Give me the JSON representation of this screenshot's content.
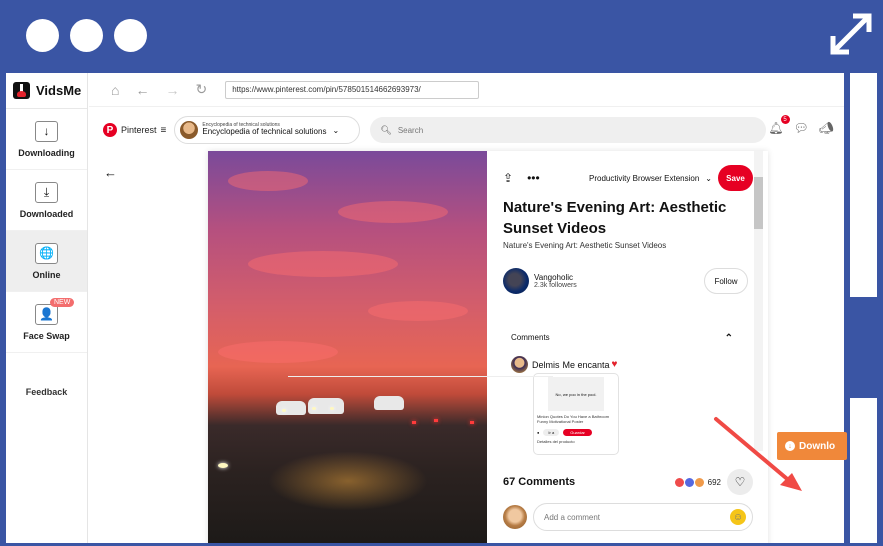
{
  "window_controls": {
    "dots": 3,
    "expand_icon": "expand-diagonal-icon"
  },
  "app": {
    "name": "VidsMe",
    "nav": [
      {
        "label": "Downloading",
        "icon": "download-arrow-icon",
        "active": false
      },
      {
        "label": "Downloaded",
        "icon": "download-tray-icon",
        "active": false
      },
      {
        "label": "Online",
        "icon": "globe-icon",
        "active": true
      },
      {
        "label": "Face Swap",
        "icon": "face-icon",
        "active": false,
        "badge": "NEW"
      }
    ],
    "feedback_label": "Feedback"
  },
  "browser": {
    "url": "https://www.pinterest.com/pin/578501514662693973/",
    "buttons": [
      "home-icon",
      "back-icon",
      "forward-icon",
      "reload-icon"
    ]
  },
  "pinterest": {
    "logo_text": "Pinterest",
    "account_small": "Encyclopedia of technical solutions",
    "account_big": "Encyclopedia of technical solutions",
    "search_placeholder": "Search",
    "notifications_count": "5"
  },
  "pin": {
    "board": "Productivity Browser Extension",
    "save_label": "Save",
    "title": "Nature's Evening Art: Aesthetic Sunset Videos",
    "description": "Nature's Evening Art: Aesthetic Sunset Videos",
    "creator": {
      "name": "Vangoholic",
      "followers": "2.3k followers"
    },
    "follow_label": "Follow",
    "comments_heading": "Comments",
    "comment": {
      "author": "Delmis",
      "text": "Me encanta",
      "attachment": {
        "image_text": "No, we poo in the pool.",
        "title": "Minion Quotes Do You Have a Bathroom Funny Motivational Poster",
        "btn_gray": "Ir a",
        "btn_red": "Guardar",
        "details": "Detalles del producto"
      }
    },
    "comments_count": "67 Comments",
    "reactions_count": "692",
    "add_comment_placeholder": "Add a comment"
  },
  "download_button": {
    "label": "Downlo"
  },
  "colors": {
    "frame": "#3a55a4",
    "pinterest_red": "#e60023",
    "download_orange": "#f0883a",
    "annotation_arrow": "#f04a45"
  }
}
